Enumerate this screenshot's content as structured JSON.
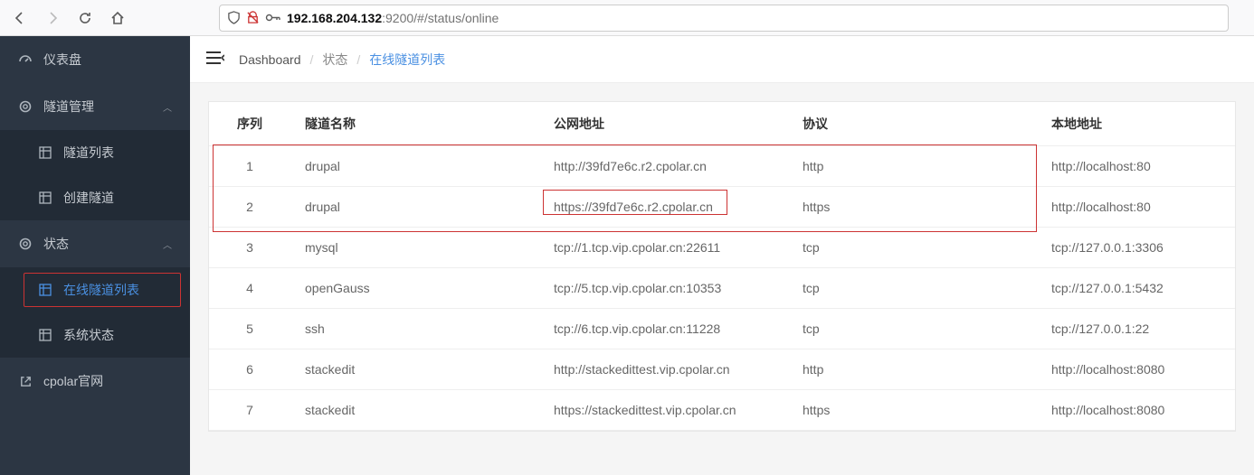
{
  "browser": {
    "url_host": "192.168.204.132",
    "url_port": ":9200",
    "url_path": "/#/status/online"
  },
  "sidebar": {
    "items": [
      {
        "label": "仪表盘",
        "icon": "gauge-icon",
        "type": "group"
      },
      {
        "label": "隧道管理",
        "icon": "circle-notch-icon",
        "type": "group",
        "chev": true
      },
      {
        "label": "隧道列表",
        "icon": "table-icon",
        "type": "sub"
      },
      {
        "label": "创建隧道",
        "icon": "table-icon",
        "type": "sub"
      },
      {
        "label": "状态",
        "icon": "circle-notch-icon",
        "type": "group",
        "chev": true
      },
      {
        "label": "在线隧道列表",
        "icon": "table-icon",
        "type": "sub",
        "active": true
      },
      {
        "label": "系统状态",
        "icon": "table-icon",
        "type": "sub"
      },
      {
        "label": "cpolar官网",
        "icon": "external-link-icon",
        "type": "group"
      }
    ]
  },
  "breadcrumb": {
    "dash": "Dashboard",
    "mid": "状态",
    "cur": "在线隧道列表"
  },
  "table": {
    "headers": {
      "seq": "序列",
      "name": "隧道名称",
      "public": "公网地址",
      "proto": "协议",
      "local": "本地地址"
    },
    "rows": [
      {
        "seq": "1",
        "name": "drupal",
        "public": "http://39fd7e6c.r2.cpolar.cn",
        "proto": "http",
        "local": "http://localhost:80"
      },
      {
        "seq": "2",
        "name": "drupal",
        "public": "https://39fd7e6c.r2.cpolar.cn",
        "proto": "https",
        "local": "http://localhost:80"
      },
      {
        "seq": "3",
        "name": "mysql",
        "public": "tcp://1.tcp.vip.cpolar.cn:22611",
        "proto": "tcp",
        "local": "tcp://127.0.0.1:3306"
      },
      {
        "seq": "4",
        "name": "openGauss",
        "public": "tcp://5.tcp.vip.cpolar.cn:10353",
        "proto": "tcp",
        "local": "tcp://127.0.0.1:5432"
      },
      {
        "seq": "5",
        "name": "ssh",
        "public": "tcp://6.tcp.vip.cpolar.cn:11228",
        "proto": "tcp",
        "local": "tcp://127.0.0.1:22"
      },
      {
        "seq": "6",
        "name": "stackedit",
        "public": "http://stackedittest.vip.cpolar.cn",
        "proto": "http",
        "local": "http://localhost:8080"
      },
      {
        "seq": "7",
        "name": "stackedit",
        "public": "https://stackedittest.vip.cpolar.cn",
        "proto": "https",
        "local": "http://localhost:8080"
      }
    ]
  }
}
